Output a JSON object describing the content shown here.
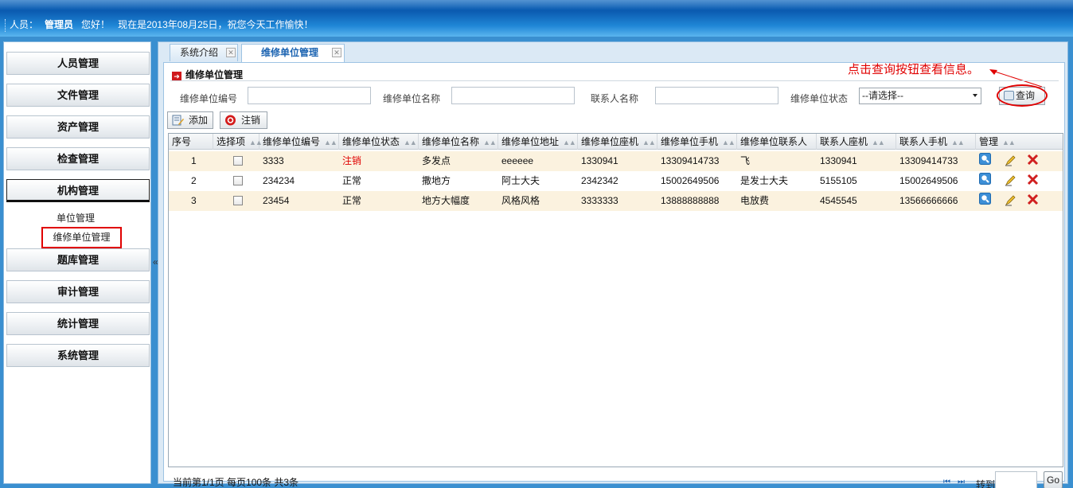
{
  "header": {
    "user_label": "人员：",
    "user_name": "管理员",
    "greeting": "您好！",
    "date_message": "现在是2013年08月25日，祝您今天工作愉快！"
  },
  "sidebar": {
    "items": [
      {
        "label": "人员管理"
      },
      {
        "label": "文件管理"
      },
      {
        "label": "资产管理"
      },
      {
        "label": "检查管理"
      },
      {
        "label": "机构管理"
      },
      {
        "label": "题库管理"
      },
      {
        "label": "审计管理"
      },
      {
        "label": "统计管理"
      },
      {
        "label": "系统管理"
      }
    ],
    "subitems": [
      {
        "label": "单位管理"
      },
      {
        "label": "维修单位管理"
      }
    ],
    "collapse_glyph": "«"
  },
  "tabs": [
    {
      "label": "系统介绍"
    },
    {
      "label": "维修单位管理"
    }
  ],
  "panel": {
    "title": "维修单位管理",
    "annotation": "点击查询按钮查看信息。"
  },
  "search": {
    "code_label": "维修单位编号",
    "name_label": "维修单位名称",
    "contact_label": "联系人名称",
    "status_label": "维修单位状态",
    "status_value": "--请选择--",
    "query_button": "查询"
  },
  "toolbar": {
    "add_label": "添加",
    "cancel_label": "注销"
  },
  "grid": {
    "columns": [
      "序号",
      "选择项",
      "维修单位编号",
      "维修单位状态",
      "维修单位名称",
      "维修单位地址",
      "维修单位座机",
      "维修单位手机",
      "维修单位联系人",
      "联系人座机",
      "联系人手机",
      "管理"
    ],
    "rows": [
      {
        "no": "1",
        "code": "3333",
        "status": "注销",
        "name": "多发点",
        "address": "eeeeee",
        "phone": "1330941",
        "mobile": "13309414733",
        "contact": "飞",
        "contact_phone": "1330941",
        "contact_mobile": "13309414733"
      },
      {
        "no": "2",
        "code": "234234",
        "status": "正常",
        "name": "撒地方",
        "address": "阿士大夫",
        "phone": "2342342",
        "mobile": "15002649506",
        "contact": "是发士大夫",
        "contact_phone": "5155105",
        "contact_mobile": "15002649506"
      },
      {
        "no": "3",
        "code": "23454",
        "status": "正常",
        "name": "地方大幅度",
        "address": "风格风格",
        "phone": "3333333",
        "mobile": "13888888888",
        "contact": "电放费",
        "contact_phone": "4545545",
        "contact_mobile": "13566666666"
      }
    ]
  },
  "pager": {
    "summary": "当前第1/1页  每页100条  共3条",
    "goto_label": "转到",
    "go_button": "Go"
  },
  "colors": {
    "banner": "#0b5bb0",
    "odd_row": "#fbf2df",
    "highlight_red": "#e00000",
    "link_blue": "#1b63b1"
  }
}
